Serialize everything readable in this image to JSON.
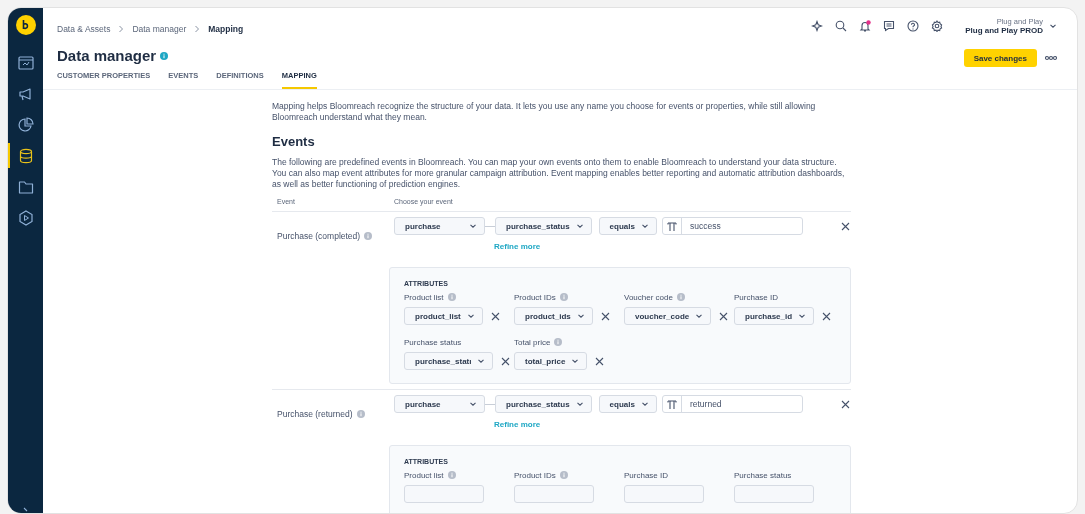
{
  "sidebar": {
    "items": [
      {
        "selected": false
      },
      {
        "selected": false
      },
      {
        "selected": false
      },
      {
        "selected": true
      },
      {
        "selected": false
      },
      {
        "selected": false
      }
    ]
  },
  "breadcrumb": [
    "Data & Assets",
    "Data manager",
    "Mapping"
  ],
  "title": "Data manager",
  "account": {
    "organization": "Plug and Play",
    "project": "Plug and Play PROD"
  },
  "notifications": {
    "unread": true
  },
  "save_button": "Save changes",
  "tabs": [
    {
      "label": "CUSTOMER PROPERTIES",
      "selected": false
    },
    {
      "label": "EVENTS",
      "selected": false
    },
    {
      "label": "DEFINITIONS",
      "selected": false
    },
    {
      "label": "MAPPING",
      "selected": true
    }
  ],
  "intro": "Mapping helps Bloomreach recognize the structure of your data. It lets you use any name you choose for events or properties, while still allowing Bloomreach understand what they mean.",
  "section_title": "Events",
  "section_description": "The following are predefined events in Bloomreach. You can map your own events onto them to enable Bloomreach to understand your data structure. You can also map event attributes for more granular campaign attribution. Event mapping enables better reporting and automatic attribution dashboards, as well as better functioning of prediction engines.",
  "columns": [
    "Event",
    "Choose your event"
  ],
  "events": [
    {
      "name": "Purchase (completed)",
      "event": "purchase",
      "property": "purchase_status",
      "operator": "equals",
      "value": "success",
      "refine": "Refine more",
      "attributes_title": "ATTRIBUTES",
      "attributes": [
        {
          "label": "Product list",
          "info": true,
          "value": "product_list"
        },
        {
          "label": "Product IDs",
          "info": true,
          "value": "product_ids"
        },
        {
          "label": "Voucher code",
          "info": true,
          "value": "voucher_code"
        },
        {
          "label": "Purchase ID",
          "info": false,
          "value": "purchase_id"
        },
        {
          "label": "Purchase status",
          "info": false,
          "value": "purchase_statı"
        },
        {
          "label": "Total price",
          "info": true,
          "value": "total_price"
        }
      ]
    },
    {
      "name": "Purchase (returned)",
      "event": "purchase",
      "property": "purchase_status",
      "operator": "equals",
      "value": "returned",
      "refine": "Refine more",
      "attributes_title": "ATTRIBUTES",
      "attributes": [
        {
          "label": "Product list",
          "info": true
        },
        {
          "label": "Product IDs",
          "info": true
        },
        {
          "label": "Purchase ID",
          "info": false
        },
        {
          "label": "Purchase status",
          "info": false
        }
      ]
    }
  ]
}
